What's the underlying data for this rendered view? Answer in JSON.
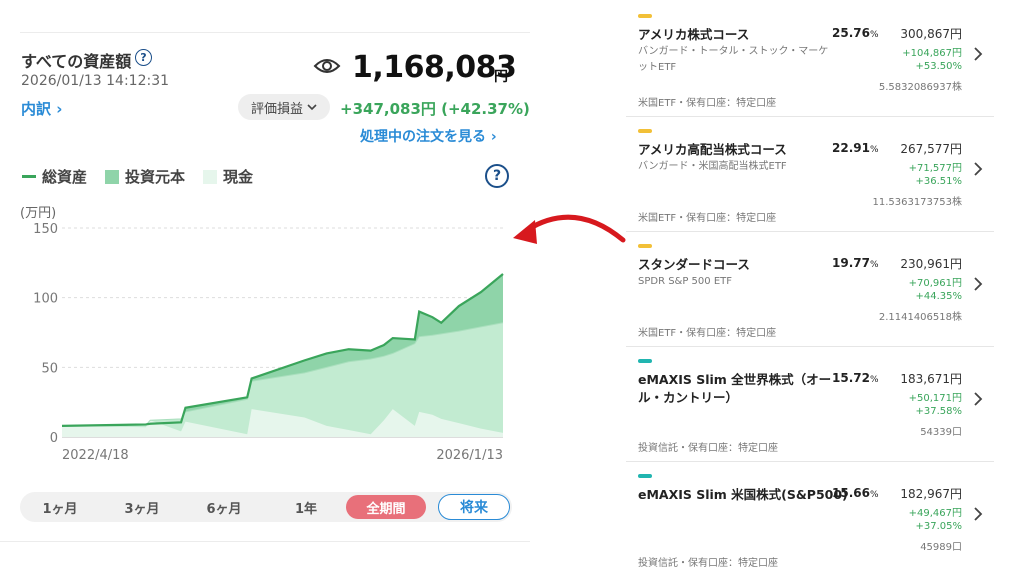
{
  "summary": {
    "title": "すべての資産額",
    "help": "?",
    "timestamp": "2026/01/13 14:12:31",
    "total_value": "1,168,083",
    "total_unit": "円",
    "breakdown_link": "内訳 ›",
    "pnl_toggle": "評価損益",
    "gain": "+347,083円 (+42.37%)",
    "pending_orders": "処理中の注文を見る ›"
  },
  "legend": {
    "total": "総資産",
    "principal": "投資元本",
    "cash": "現金",
    "help": "?"
  },
  "colors": {
    "total_line": "#3aa55b",
    "total_fill": "#8fd4a9",
    "principal_fill": "#c2ebd1",
    "cash_fill": "#e6f6ec",
    "accent_pink": "#e8707a",
    "link_blue": "#2a8bd6",
    "arrow_red": "#d7191e"
  },
  "chart_data": {
    "type": "area",
    "ylabel": "(万円)",
    "ylim": [
      0,
      150
    ],
    "yticks": [
      "0",
      "50",
      "100",
      "150"
    ],
    "xtick_labels": [
      "2022/4/18",
      "2026/1/13"
    ],
    "series": [
      {
        "name": "総資産",
        "x": [
          0,
          0.19,
          0.2,
          0.27,
          0.28,
          0.42,
          0.43,
          0.55,
          0.6,
          0.65,
          0.7,
          0.73,
          0.75,
          0.8,
          0.81,
          0.84,
          0.86,
          0.9,
          0.95,
          1.0
        ],
        "values": [
          8,
          9,
          9.5,
          10.5,
          21,
          28.5,
          42,
          55,
          60,
          63,
          62,
          66,
          71,
          70,
          90,
          86,
          82,
          94,
          104,
          117
        ]
      },
      {
        "name": "投資元本",
        "x": [
          0,
          0.19,
          0.2,
          0.27,
          0.28,
          0.42,
          0.43,
          0.55,
          0.6,
          0.65,
          0.7,
          0.73,
          0.75,
          0.8,
          0.81,
          0.84,
          0.86,
          0.9,
          0.95,
          1.0
        ],
        "values": [
          8,
          8.5,
          12,
          13,
          18,
          27,
          40,
          46,
          50,
          54,
          56,
          58,
          60,
          67,
          72,
          73,
          74,
          76,
          79,
          82
        ]
      },
      {
        "name": "現金",
        "x": [
          0,
          0.19,
          0.2,
          0.27,
          0.28,
          0.42,
          0.43,
          0.55,
          0.6,
          0.65,
          0.7,
          0.73,
          0.75,
          0.8,
          0.81,
          0.84,
          0.86,
          0.9,
          0.95,
          1.0
        ],
        "values": [
          8,
          7,
          12,
          4,
          11,
          2,
          20,
          14,
          8,
          5,
          2,
          12,
          20,
          8,
          18,
          16,
          13,
          10,
          6,
          3
        ]
      }
    ]
  },
  "periods": [
    {
      "label": "1ヶ月",
      "active": false
    },
    {
      "label": "3ヶ月",
      "active": false
    },
    {
      "label": "6ヶ月",
      "active": false
    },
    {
      "label": "1年",
      "active": false
    },
    {
      "label": "全期間",
      "active": true
    }
  ],
  "future_button": "将来",
  "holdings": [
    {
      "tag_color": "#f2c037",
      "name": "アメリカ株式コース",
      "name2": "",
      "fund": "バンガード・トータル・ストック・マーケットETF",
      "share_pct": "25.76",
      "pct_unit": "%",
      "value": "300,867円",
      "pnl": "+104,867円",
      "rate": "+53.50%",
      "quantity": "5.5832086937株",
      "account": "米国ETF・保有口座：特定口座"
    },
    {
      "tag_color": "#f2c037",
      "name": "アメリカ高配当株式コース",
      "name2": "",
      "fund": "バンガード・米国高配当株式ETF",
      "share_pct": "22.91",
      "pct_unit": "%",
      "value": "267,577円",
      "pnl": "+71,577円",
      "rate": "+36.51%",
      "quantity": "11.5363173753株",
      "account": "米国ETF・保有口座：特定口座"
    },
    {
      "tag_color": "#f2c037",
      "name": "スタンダードコース",
      "name2": "",
      "fund": "SPDR S&P 500 ETF",
      "share_pct": "19.77",
      "pct_unit": "%",
      "value": "230,961円",
      "pnl": "+70,961円",
      "rate": "+44.35%",
      "quantity": "2.1141406518株",
      "account": "米国ETF・保有口座：特定口座"
    },
    {
      "tag_color": "#21b5b0",
      "name": "eMAXIS Slim 全世界株式（オー",
      "name2": "ル・カントリー）",
      "fund": "",
      "share_pct": "15.72",
      "pct_unit": "%",
      "value": "183,671円",
      "pnl": "+50,171円",
      "rate": "+37.58%",
      "quantity": "54339口",
      "account": "投資信託・保有口座：特定口座"
    },
    {
      "tag_color": "#21b5b0",
      "name": "eMAXIS Slim 米国株式(S&P500)",
      "name2": "",
      "fund": "",
      "share_pct": "15.66",
      "pct_unit": "%",
      "value": "182,967円",
      "pnl": "+49,467円",
      "rate": "+37.05%",
      "quantity": "45989口",
      "account": "投資信託・保有口座：特定口座"
    }
  ]
}
